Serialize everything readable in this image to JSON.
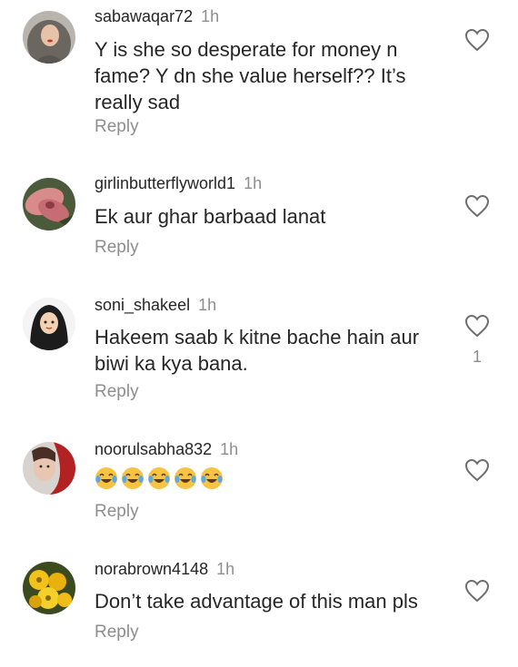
{
  "comments": [
    {
      "username": "sabawaqar72",
      "time": "1h",
      "text": "Y is she so desperate for money n fame? Y dn she value herself?? It’s really sad",
      "reply_label": "Reply",
      "avatar_icon": "user-avatar-woman-hijab",
      "like_icon": "heart-outline-icon",
      "like_count": ""
    },
    {
      "username": "girlinbutterflyworld1",
      "time": "1h",
      "text": "Ek aur ghar barbaad lanat",
      "reply_label": "Reply",
      "avatar_icon": "user-avatar-flower",
      "like_icon": "heart-outline-icon",
      "like_count": ""
    },
    {
      "username": "soni_shakeel",
      "time": "1h",
      "text": "Hakeem saab k kitne bache hain aur biwi ka kya bana.",
      "reply_label": "Reply",
      "avatar_icon": "user-avatar-hijab-cartoon",
      "like_icon": "heart-outline-icon",
      "like_count": "1"
    },
    {
      "username": "noorulsabha832",
      "time": "1h",
      "text": "😂😂😂😂😂",
      "reply_label": "Reply",
      "avatar_icon": "user-avatar-woman-red",
      "like_icon": "heart-outline-icon",
      "like_count": ""
    },
    {
      "username": "norabrown4148",
      "time": "1h",
      "text": "Don’t take advantage of this man pls",
      "reply_label": "Reply",
      "avatar_icon": "user-avatar-yellow-flowers",
      "like_icon": "heart-outline-icon",
      "like_count": ""
    }
  ],
  "colors": {
    "text": "#262626",
    "muted": "#8e8e8e",
    "background": "#ffffff"
  }
}
